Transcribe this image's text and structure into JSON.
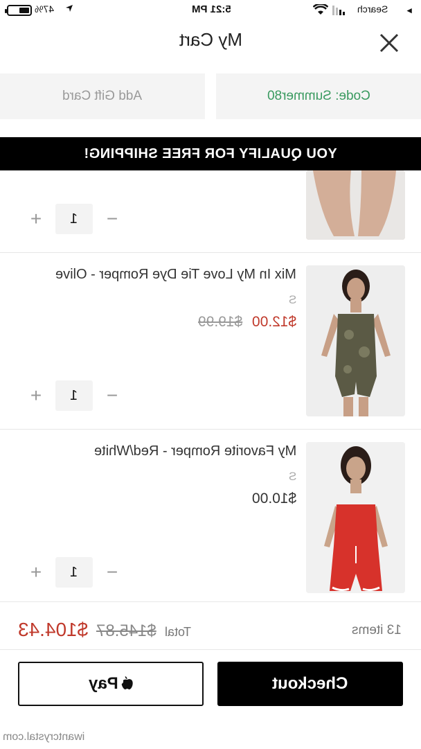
{
  "status_bar": {
    "time": "5:21 PM",
    "battery": "47%",
    "back_app": "Search"
  },
  "header": {
    "title": "My Cart"
  },
  "promo": {
    "code_label": "Code: Summer80",
    "gift_card_label": "Add Gift Card"
  },
  "banner": {
    "text": "YOU QUALIFY FOR FREE SHIPPING!"
  },
  "items": [
    {
      "name": "",
      "size": "",
      "quantity": "1"
    },
    {
      "name": "Mix In My Love Tie Dye Romper - Olive",
      "size": "S",
      "sale_price": "$12.00",
      "original_price": "$19.99",
      "quantity": "1",
      "image_color": "#5b5a45"
    },
    {
      "name": "My Favorite Romper - Red/White",
      "size": "S",
      "price": "$10.00",
      "quantity": "1",
      "image_color": "#d7322b"
    }
  ],
  "summary": {
    "item_count": "13 items",
    "total_label": "Total",
    "original_total": "$145.87",
    "sale_total": "$104.43"
  },
  "buttons": {
    "checkout": "Checkout",
    "apple_pay": "Pay"
  },
  "watermark": "iwantcrystal.com",
  "colors": {
    "sale": "#c0392b",
    "code": "#3a9a60",
    "banner_bg": "#000000"
  }
}
